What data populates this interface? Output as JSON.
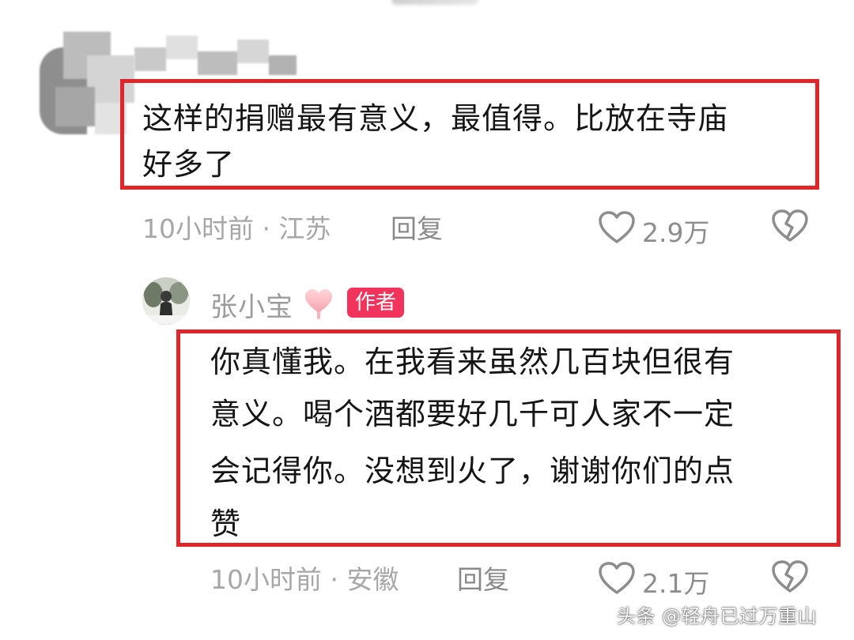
{
  "comment1": {
    "text_line1": "这样的捐赠最有意义，最值得。比放在寺庙",
    "text_line2": "好多了",
    "time": "10小时前",
    "location": "江苏",
    "reply_label": "回复",
    "likes": "2.9万"
  },
  "reply": {
    "username": "张小宝",
    "badge": "作者",
    "text_line1": "你真懂我。在我看来虽然几百块但很有",
    "text_line2": "意义。喝个酒都要好几千可人家不一定",
    "text_line3": "会记得你。没想到火了，谢谢你们的点",
    "text_line4": "赞",
    "time": "10小时前",
    "location": "安徽",
    "reply_label": "回复",
    "likes": "2.1万"
  },
  "watermark": "头条 @轻舟已过万重山",
  "colors": {
    "highlight_border": "#e0262b",
    "author_badge": "#f2345c",
    "meta_text": "#a7a7a7"
  }
}
